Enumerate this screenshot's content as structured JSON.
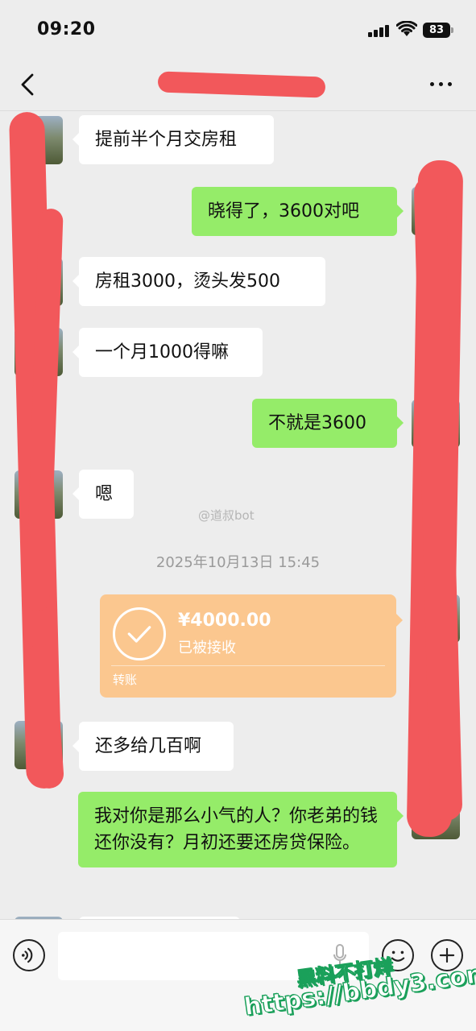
{
  "status_bar": {
    "time": "09:20",
    "battery": "83"
  },
  "nav": {
    "title": ""
  },
  "messages": [
    {
      "id": 1,
      "side": "left",
      "text": "提前半个月交房租"
    },
    {
      "id": 2,
      "side": "right",
      "text": "晓得了，3600对吧"
    },
    {
      "id": 3,
      "side": "left",
      "text": "房租3000，烫头发500"
    },
    {
      "id": 4,
      "side": "left",
      "text": "一个月1000得嘛"
    },
    {
      "id": 5,
      "side": "right",
      "text": "不就是3600"
    },
    {
      "id": 6,
      "side": "left",
      "text": "嗯"
    },
    {
      "id": 7,
      "side": "left",
      "text": "还多给几百啊"
    },
    {
      "id": 8,
      "side": "right",
      "text": "我对你是那么小气的人？你老弟的钱还你没有？月初还要还房贷保险。"
    }
  ],
  "timestamp": "2025年10月13日 15:45",
  "transfer": {
    "amount": "¥4000.00",
    "status": "已被接收",
    "label": "转账"
  },
  "watermarks": {
    "weibo": "@道叔bot",
    "site_line1": "黑料不打烊",
    "site_line2": "https://bbdy3.com"
  },
  "colors": {
    "my_bubble": "#95ec69",
    "their_bubble": "#ffffff",
    "transfer": "#fbc78f",
    "redaction": "#f2585b",
    "background": "#ededed"
  },
  "icons": [
    "back-icon",
    "more-icon",
    "voice-icon",
    "mic-icon",
    "emoji-icon",
    "plus-icon",
    "check-icon",
    "signal-icon",
    "wifi-icon",
    "battery-icon"
  ]
}
